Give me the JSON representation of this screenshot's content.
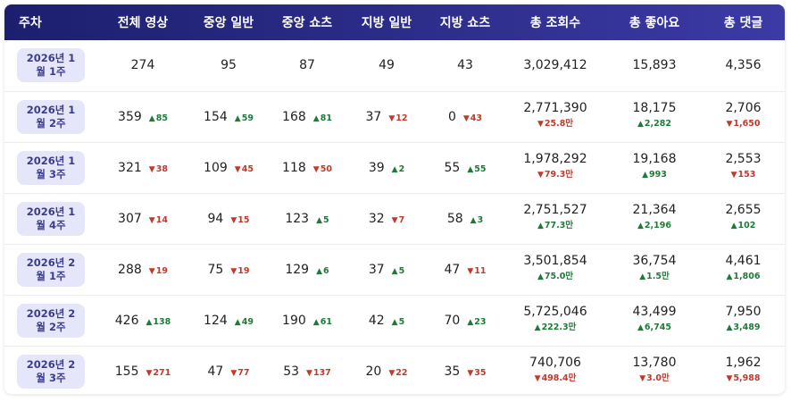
{
  "header": [
    "주차",
    "전체 영상",
    "중앙 일반",
    "중앙 쇼츠",
    "지방 일반",
    "지방 쇼츠",
    "총 조회수",
    "총 좋아요",
    "총 댓글"
  ],
  "rows": [
    {
      "week": "2026년 1월 1주",
      "cells": [
        {
          "v": "274",
          "d": "",
          "dir": ""
        },
        {
          "v": "95",
          "d": "",
          "dir": ""
        },
        {
          "v": "87",
          "d": "",
          "dir": ""
        },
        {
          "v": "49",
          "d": "",
          "dir": ""
        },
        {
          "v": "43",
          "d": "",
          "dir": ""
        },
        {
          "v": "3,029,412",
          "d": "",
          "dir": ""
        },
        {
          "v": "15,893",
          "d": "",
          "dir": ""
        },
        {
          "v": "4,356",
          "d": "",
          "dir": ""
        }
      ]
    },
    {
      "week": "2026년 1월 2주",
      "cells": [
        {
          "v": "359",
          "d": "85",
          "dir": "up"
        },
        {
          "v": "154",
          "d": "59",
          "dir": "up"
        },
        {
          "v": "168",
          "d": "81",
          "dir": "up"
        },
        {
          "v": "37",
          "d": "12",
          "dir": "down"
        },
        {
          "v": "0",
          "d": "43",
          "dir": "down"
        },
        {
          "v": "2,771,390",
          "d": "25.8만",
          "dir": "down"
        },
        {
          "v": "18,175",
          "d": "2,282",
          "dir": "up"
        },
        {
          "v": "2,706",
          "d": "1,650",
          "dir": "down"
        }
      ]
    },
    {
      "week": "2026년 1월 3주",
      "cells": [
        {
          "v": "321",
          "d": "38",
          "dir": "down"
        },
        {
          "v": "109",
          "d": "45",
          "dir": "down"
        },
        {
          "v": "118",
          "d": "50",
          "dir": "down"
        },
        {
          "v": "39",
          "d": "2",
          "dir": "up"
        },
        {
          "v": "55",
          "d": "55",
          "dir": "up"
        },
        {
          "v": "1,978,292",
          "d": "79.3만",
          "dir": "down"
        },
        {
          "v": "19,168",
          "d": "993",
          "dir": "up"
        },
        {
          "v": "2,553",
          "d": "153",
          "dir": "down"
        }
      ]
    },
    {
      "week": "2026년 1월 4주",
      "cells": [
        {
          "v": "307",
          "d": "14",
          "dir": "down"
        },
        {
          "v": "94",
          "d": "15",
          "dir": "down"
        },
        {
          "v": "123",
          "d": "5",
          "dir": "up"
        },
        {
          "v": "32",
          "d": "7",
          "dir": "down"
        },
        {
          "v": "58",
          "d": "3",
          "dir": "up"
        },
        {
          "v": "2,751,527",
          "d": "77.3만",
          "dir": "up"
        },
        {
          "v": "21,364",
          "d": "2,196",
          "dir": "up"
        },
        {
          "v": "2,655",
          "d": "102",
          "dir": "up"
        }
      ]
    },
    {
      "week": "2026년 2월 1주",
      "cells": [
        {
          "v": "288",
          "d": "19",
          "dir": "down"
        },
        {
          "v": "75",
          "d": "19",
          "dir": "down"
        },
        {
          "v": "129",
          "d": "6",
          "dir": "up"
        },
        {
          "v": "37",
          "d": "5",
          "dir": "up"
        },
        {
          "v": "47",
          "d": "11",
          "dir": "down"
        },
        {
          "v": "3,501,854",
          "d": "75.0만",
          "dir": "up"
        },
        {
          "v": "36,754",
          "d": "1.5만",
          "dir": "up"
        },
        {
          "v": "4,461",
          "d": "1,806",
          "dir": "up"
        }
      ]
    },
    {
      "week": "2026년 2월 2주",
      "cells": [
        {
          "v": "426",
          "d": "138",
          "dir": "up"
        },
        {
          "v": "124",
          "d": "49",
          "dir": "up"
        },
        {
          "v": "190",
          "d": "61",
          "dir": "up"
        },
        {
          "v": "42",
          "d": "5",
          "dir": "up"
        },
        {
          "v": "70",
          "d": "23",
          "dir": "up"
        },
        {
          "v": "5,725,046",
          "d": "222.3만",
          "dir": "up"
        },
        {
          "v": "43,499",
          "d": "6,745",
          "dir": "up"
        },
        {
          "v": "7,950",
          "d": "3,489",
          "dir": "up"
        }
      ]
    },
    {
      "week": "2026년 2월 3주",
      "cells": [
        {
          "v": "155",
          "d": "271",
          "dir": "down"
        },
        {
          "v": "47",
          "d": "77",
          "dir": "down"
        },
        {
          "v": "53",
          "d": "137",
          "dir": "down"
        },
        {
          "v": "20",
          "d": "22",
          "dir": "down"
        },
        {
          "v": "35",
          "d": "35",
          "dir": "down"
        },
        {
          "v": "740,706",
          "d": "498.4만",
          "dir": "down"
        },
        {
          "v": "13,780",
          "d": "3.0만",
          "dir": "down"
        },
        {
          "v": "1,962",
          "d": "5,988",
          "dir": "down"
        }
      ]
    }
  ],
  "colors": {
    "header_start": "#1c1f6e",
    "header_end": "#3c3aa6",
    "up": "#1f7a3a",
    "down": "#c0392b",
    "pill_bg": "#e6e6fb",
    "pill_text": "#3a3d8c"
  }
}
